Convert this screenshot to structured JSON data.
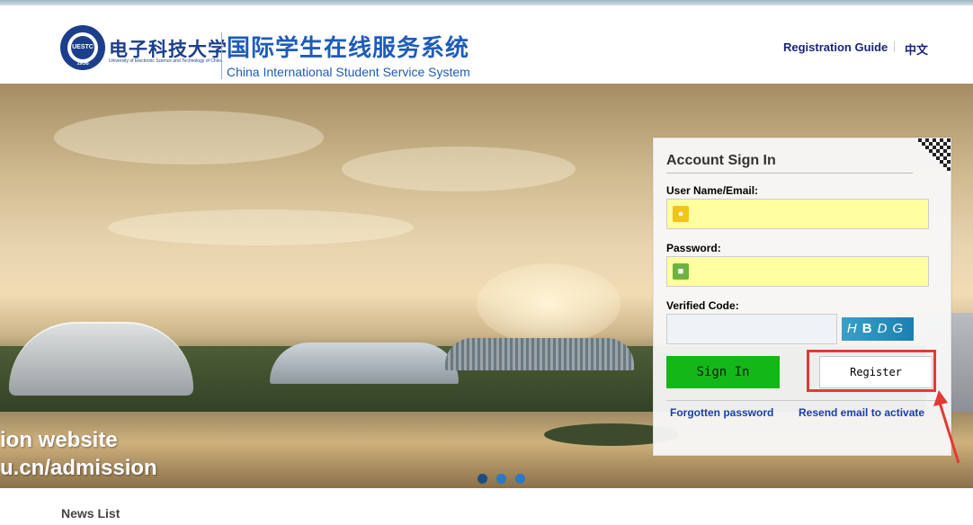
{
  "header": {
    "uni_name_cn": "电子科技大学",
    "uni_name_en": "University of Electronic Science and Technology of China",
    "seal_text": "UESTC",
    "seal_year": "1956",
    "system_cn": "国际学生在线服务系统",
    "system_en": "China International Student Service System",
    "nav": {
      "registration_guide": "Registration Guide",
      "language": "中文"
    }
  },
  "banner": {
    "line1": "ion website",
    "line2": "u.cn/admission",
    "slides": 3,
    "active_slide": 1
  },
  "login": {
    "title": "Account Sign In",
    "username_label": "User Name/Email:",
    "username_value": "",
    "password_label": "Password:",
    "password_value": "",
    "code_label": "Verified Code:",
    "code_value": "",
    "captcha": [
      "H",
      "B",
      "D",
      "G"
    ],
    "sign_in": "Sign In",
    "register": "Register",
    "forgot": "Forgotten password",
    "resend": "Resend email to activate"
  },
  "news": {
    "title": "News List"
  },
  "colors": {
    "brand_blue": "#1f5cb8",
    "sign_in_green": "#13b818",
    "highlight_red": "#e53935",
    "input_yellow": "#ffff9f"
  }
}
